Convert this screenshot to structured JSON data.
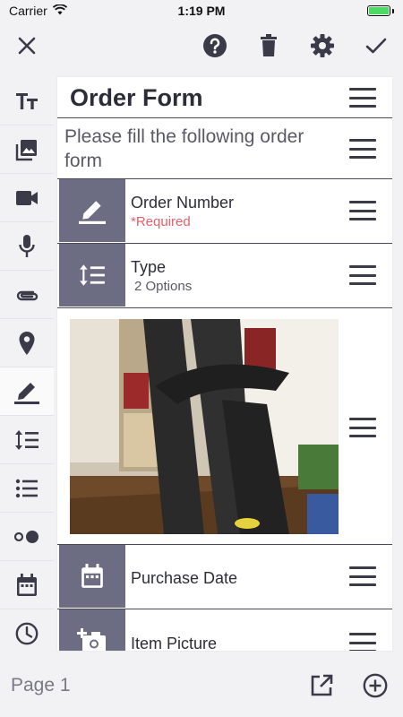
{
  "status_bar": {
    "carrier": "Carrier",
    "time": "1:19 PM",
    "battery_color": "#4cd964"
  },
  "toolbar": {
    "close_icon": "close-icon",
    "help_icon": "help-icon",
    "delete_icon": "trash-icon",
    "settings_icon": "gear-icon",
    "done_icon": "checkmark-icon"
  },
  "sidebar": {
    "items": [
      {
        "icon": "text-icon"
      },
      {
        "icon": "image-icon"
      },
      {
        "icon": "video-icon"
      },
      {
        "icon": "microphone-icon"
      },
      {
        "icon": "attachment-icon"
      },
      {
        "icon": "location-icon"
      },
      {
        "icon": "pencil-icon",
        "active": true
      },
      {
        "icon": "choice-list-icon"
      },
      {
        "icon": "bullet-list-icon"
      },
      {
        "icon": "toggle-icon"
      },
      {
        "icon": "calendar-icon"
      },
      {
        "icon": "clock-icon"
      }
    ]
  },
  "form": {
    "title": "Order Form",
    "description": "Please fill the following order form",
    "fields": [
      {
        "label": "Order Number",
        "sub": "*Required",
        "sub_color": "#e8606a",
        "icon": "pencil-icon"
      },
      {
        "label": "Type",
        "sub": "2 Options",
        "sub_color": "#5a5a66",
        "icon": "choice-list-icon"
      },
      {
        "type": "image",
        "icon": "photo-thumbnail"
      },
      {
        "label": "Purchase Date",
        "icon": "calendar-icon"
      },
      {
        "label": "Item Picture",
        "icon": "add-photo-icon"
      }
    ],
    "accent_color": "#6c6c82",
    "divider_color": "#4a4a5e"
  },
  "bottom_bar": {
    "page_label": "Page 1",
    "share_icon": "open-external-icon",
    "add_icon": "add-circle-icon"
  }
}
